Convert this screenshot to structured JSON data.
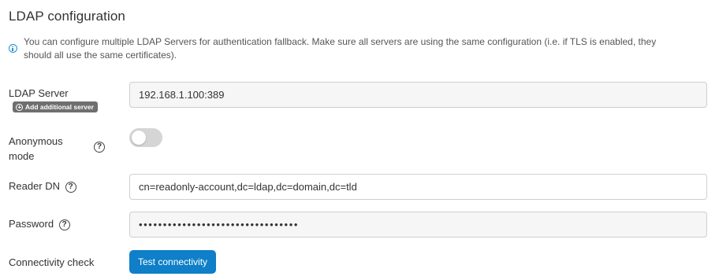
{
  "section": {
    "title": "LDAP configuration",
    "info_line1": "You can configure multiple LDAP Servers for authentication fallback. Make sure all servers are using the same configuration (i.e. if TLS is enabled, they",
    "info_line2": "should all use the same certificates)."
  },
  "ldap_server": {
    "label": "LDAP Server",
    "value": "192.168.1.100:389",
    "add_label": "Add additional server"
  },
  "anonymous_mode": {
    "label_line1": "Anonymous",
    "label_line2": "mode",
    "help": "?",
    "enabled": false
  },
  "reader_dn": {
    "label": "Reader DN",
    "help": "?",
    "value": "cn=readonly-account,dc=ldap,dc=domain,dc=tld"
  },
  "password": {
    "label": "Password",
    "help": "?",
    "masked_value": "•••••••••••••••••••••••••••••••••"
  },
  "connectivity": {
    "label": "Connectivity check",
    "button_label": "Test connectivity"
  },
  "colors": {
    "accent": "#0e7fc8",
    "info_icon": "#1d8fd8",
    "badge": "#6f6f6f",
    "toggle_off": "#d5d5d5"
  }
}
